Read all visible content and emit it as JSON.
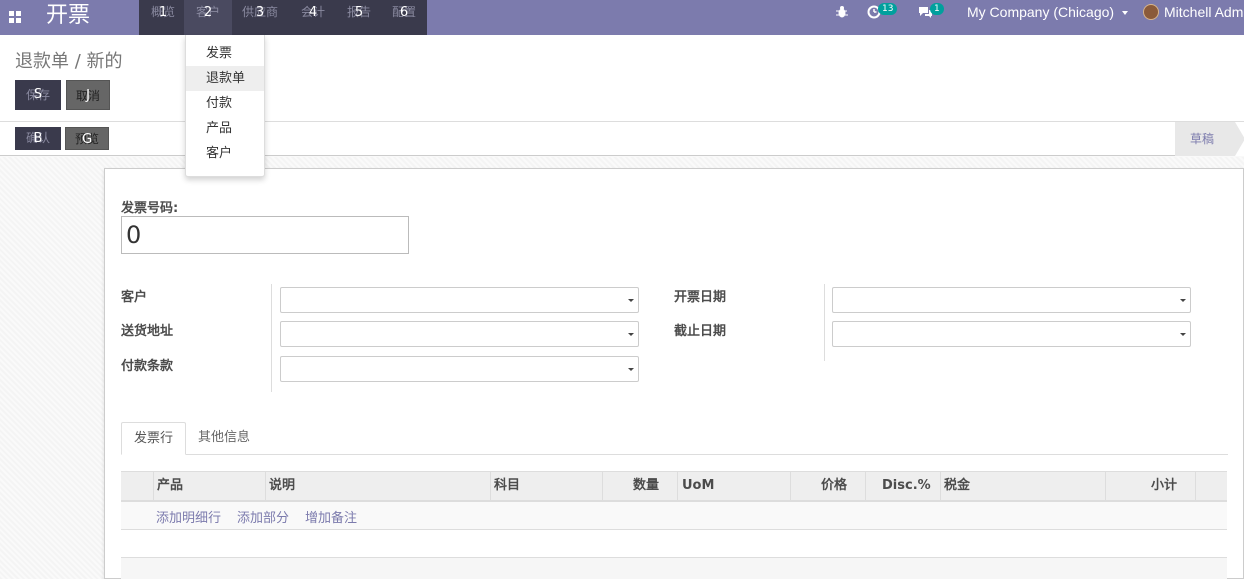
{
  "navbar": {
    "brand": "开票",
    "menu": [
      {
        "key": "1",
        "label": "概览"
      },
      {
        "key": "2",
        "label": "客户"
      },
      {
        "key": "3",
        "label": "供应商"
      },
      {
        "key": "4",
        "label": "会计"
      },
      {
        "key": "5",
        "label": "报告"
      },
      {
        "key": "6",
        "label": "配置"
      }
    ],
    "activity_count": "13",
    "message_count": "1",
    "company": "My Company (Chicago)",
    "user": "Mitchell Admin"
  },
  "dropdown": {
    "items": [
      "发票",
      "退款单",
      "付款",
      "产品",
      "客户"
    ],
    "active_index": 1
  },
  "control_panel": {
    "breadcrumb": "退款单 / 新的",
    "save": {
      "key": "S",
      "label": "保存"
    },
    "discard": {
      "key": "J",
      "label": "取消"
    },
    "validate": {
      "key": "B",
      "label": "确认"
    },
    "preview": {
      "key": "G",
      "label": "预览"
    },
    "status": "草稿"
  },
  "form": {
    "invoice_number_label": "发票号码:",
    "invoice_number_value": "0",
    "customer_label": "客户",
    "delivery_address_label": "送货地址",
    "payment_terms_label": "付款条款",
    "invoice_date_label": "开票日期",
    "due_date_label": "截止日期"
  },
  "tabs": {
    "lines": "发票行",
    "other_info": "其他信息"
  },
  "table": {
    "columns": [
      "产品",
      "说明",
      "科目",
      "数量",
      "UoM",
      "价格",
      "Disc.%",
      "税金",
      "小计"
    ],
    "add_line": "添加明细行",
    "add_section": "添加部分",
    "add_note": "增加备注"
  }
}
